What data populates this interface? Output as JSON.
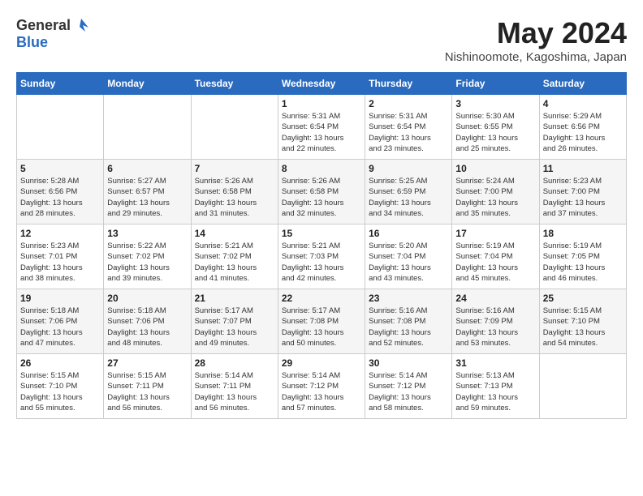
{
  "header": {
    "logo_general": "General",
    "logo_blue": "Blue",
    "month_title": "May 2024",
    "location": "Nishinoomote, Kagoshima, Japan"
  },
  "weekdays": [
    "Sunday",
    "Monday",
    "Tuesday",
    "Wednesday",
    "Thursday",
    "Friday",
    "Saturday"
  ],
  "weeks": [
    [
      {
        "day": "",
        "info": ""
      },
      {
        "day": "",
        "info": ""
      },
      {
        "day": "",
        "info": ""
      },
      {
        "day": "1",
        "info": "Sunrise: 5:31 AM\nSunset: 6:54 PM\nDaylight: 13 hours\nand 22 minutes."
      },
      {
        "day": "2",
        "info": "Sunrise: 5:31 AM\nSunset: 6:54 PM\nDaylight: 13 hours\nand 23 minutes."
      },
      {
        "day": "3",
        "info": "Sunrise: 5:30 AM\nSunset: 6:55 PM\nDaylight: 13 hours\nand 25 minutes."
      },
      {
        "day": "4",
        "info": "Sunrise: 5:29 AM\nSunset: 6:56 PM\nDaylight: 13 hours\nand 26 minutes."
      }
    ],
    [
      {
        "day": "5",
        "info": "Sunrise: 5:28 AM\nSunset: 6:56 PM\nDaylight: 13 hours\nand 28 minutes."
      },
      {
        "day": "6",
        "info": "Sunrise: 5:27 AM\nSunset: 6:57 PM\nDaylight: 13 hours\nand 29 minutes."
      },
      {
        "day": "7",
        "info": "Sunrise: 5:26 AM\nSunset: 6:58 PM\nDaylight: 13 hours\nand 31 minutes."
      },
      {
        "day": "8",
        "info": "Sunrise: 5:26 AM\nSunset: 6:58 PM\nDaylight: 13 hours\nand 32 minutes."
      },
      {
        "day": "9",
        "info": "Sunrise: 5:25 AM\nSunset: 6:59 PM\nDaylight: 13 hours\nand 34 minutes."
      },
      {
        "day": "10",
        "info": "Sunrise: 5:24 AM\nSunset: 7:00 PM\nDaylight: 13 hours\nand 35 minutes."
      },
      {
        "day": "11",
        "info": "Sunrise: 5:23 AM\nSunset: 7:00 PM\nDaylight: 13 hours\nand 37 minutes."
      }
    ],
    [
      {
        "day": "12",
        "info": "Sunrise: 5:23 AM\nSunset: 7:01 PM\nDaylight: 13 hours\nand 38 minutes."
      },
      {
        "day": "13",
        "info": "Sunrise: 5:22 AM\nSunset: 7:02 PM\nDaylight: 13 hours\nand 39 minutes."
      },
      {
        "day": "14",
        "info": "Sunrise: 5:21 AM\nSunset: 7:02 PM\nDaylight: 13 hours\nand 41 minutes."
      },
      {
        "day": "15",
        "info": "Sunrise: 5:21 AM\nSunset: 7:03 PM\nDaylight: 13 hours\nand 42 minutes."
      },
      {
        "day": "16",
        "info": "Sunrise: 5:20 AM\nSunset: 7:04 PM\nDaylight: 13 hours\nand 43 minutes."
      },
      {
        "day": "17",
        "info": "Sunrise: 5:19 AM\nSunset: 7:04 PM\nDaylight: 13 hours\nand 45 minutes."
      },
      {
        "day": "18",
        "info": "Sunrise: 5:19 AM\nSunset: 7:05 PM\nDaylight: 13 hours\nand 46 minutes."
      }
    ],
    [
      {
        "day": "19",
        "info": "Sunrise: 5:18 AM\nSunset: 7:06 PM\nDaylight: 13 hours\nand 47 minutes."
      },
      {
        "day": "20",
        "info": "Sunrise: 5:18 AM\nSunset: 7:06 PM\nDaylight: 13 hours\nand 48 minutes."
      },
      {
        "day": "21",
        "info": "Sunrise: 5:17 AM\nSunset: 7:07 PM\nDaylight: 13 hours\nand 49 minutes."
      },
      {
        "day": "22",
        "info": "Sunrise: 5:17 AM\nSunset: 7:08 PM\nDaylight: 13 hours\nand 50 minutes."
      },
      {
        "day": "23",
        "info": "Sunrise: 5:16 AM\nSunset: 7:08 PM\nDaylight: 13 hours\nand 52 minutes."
      },
      {
        "day": "24",
        "info": "Sunrise: 5:16 AM\nSunset: 7:09 PM\nDaylight: 13 hours\nand 53 minutes."
      },
      {
        "day": "25",
        "info": "Sunrise: 5:15 AM\nSunset: 7:10 PM\nDaylight: 13 hours\nand 54 minutes."
      }
    ],
    [
      {
        "day": "26",
        "info": "Sunrise: 5:15 AM\nSunset: 7:10 PM\nDaylight: 13 hours\nand 55 minutes."
      },
      {
        "day": "27",
        "info": "Sunrise: 5:15 AM\nSunset: 7:11 PM\nDaylight: 13 hours\nand 56 minutes."
      },
      {
        "day": "28",
        "info": "Sunrise: 5:14 AM\nSunset: 7:11 PM\nDaylight: 13 hours\nand 56 minutes."
      },
      {
        "day": "29",
        "info": "Sunrise: 5:14 AM\nSunset: 7:12 PM\nDaylight: 13 hours\nand 57 minutes."
      },
      {
        "day": "30",
        "info": "Sunrise: 5:14 AM\nSunset: 7:12 PM\nDaylight: 13 hours\nand 58 minutes."
      },
      {
        "day": "31",
        "info": "Sunrise: 5:13 AM\nSunset: 7:13 PM\nDaylight: 13 hours\nand 59 minutes."
      },
      {
        "day": "",
        "info": ""
      }
    ]
  ]
}
